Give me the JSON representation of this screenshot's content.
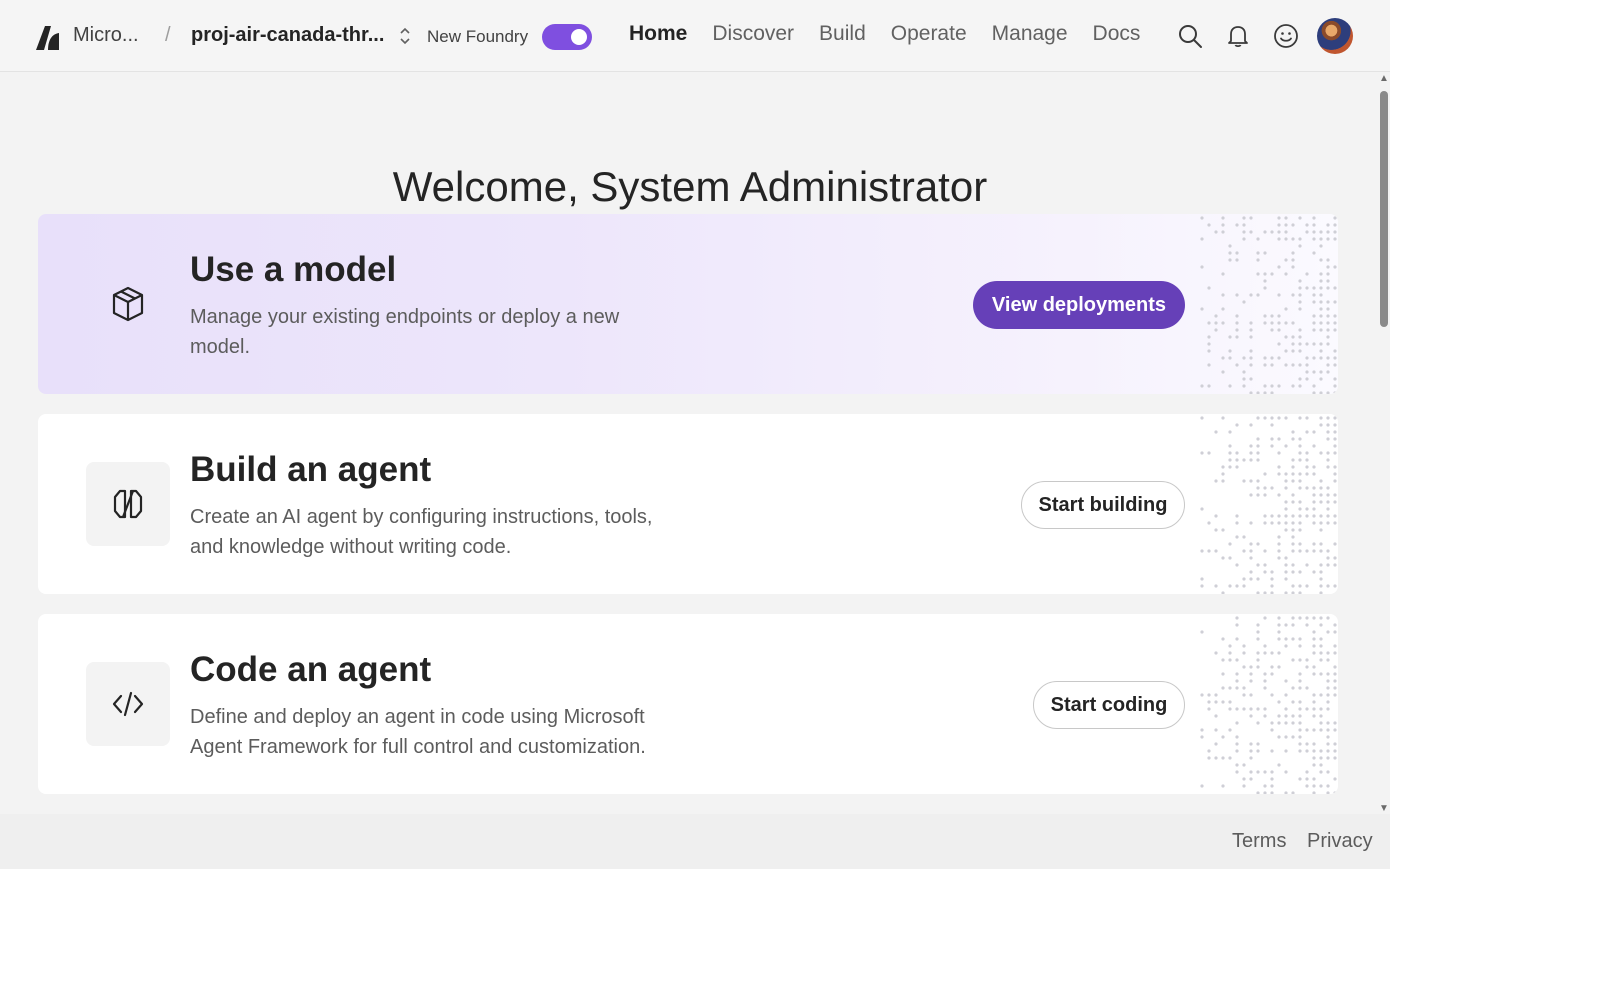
{
  "header": {
    "brand": "Micro...",
    "separator": "/",
    "project": "proj-air-canada-thr...",
    "foundry_label": "New Foundry",
    "nav": [
      {
        "label": "Home",
        "active": true
      },
      {
        "label": "Discover"
      },
      {
        "label": "Build"
      },
      {
        "label": "Operate"
      },
      {
        "label": "Manage"
      },
      {
        "label": "Docs"
      }
    ],
    "icons": [
      "search-icon",
      "bell-icon",
      "feedback-smiley-icon",
      "avatar"
    ]
  },
  "main": {
    "welcome": "Welcome, System Administrator",
    "cards": [
      {
        "title": "Use a model",
        "description": "Manage your existing endpoints or deploy a new model.",
        "button": "View deployments",
        "icon": "cube-icon"
      },
      {
        "title": "Build an agent",
        "description": "Create an AI agent by configuring instructions, tools, and knowledge without writing code.",
        "button": "Start building",
        "icon": "agent-icon"
      },
      {
        "title": "Code an agent",
        "description": "Define and deploy an agent in code using Microsoft Agent Framework for full control and customization.",
        "button": "Start coding",
        "icon": "code-icon"
      }
    ]
  },
  "footer": {
    "terms": "Terms",
    "privacy": "Privacy"
  },
  "colors": {
    "accent": "#6640b8",
    "toggle": "#7f4fe0",
    "highlight_card": "#e8e0fa"
  }
}
